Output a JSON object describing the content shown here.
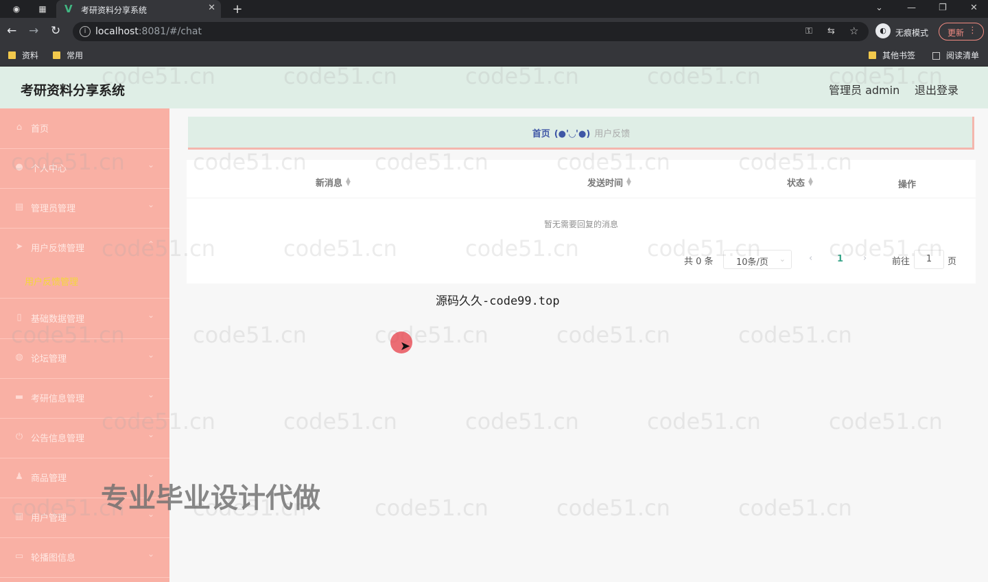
{
  "browser": {
    "tab_title": "考研资料分享系统",
    "tab_favicon": "V",
    "url_host": "localhost",
    "url_rest": ":8081/#/chat",
    "incognito_label": "无痕模式",
    "update_label": "更新",
    "bookmarks": [
      "资料",
      "常用"
    ],
    "bookmarks_right": [
      "其他书签",
      "阅读清单"
    ]
  },
  "app": {
    "brand": "考研资料分享系统",
    "user": "管理员 admin",
    "logout": "退出登录"
  },
  "sidebar": {
    "items": [
      {
        "label": "首页",
        "icon": "home-icon"
      },
      {
        "label": "个人中心",
        "icon": "user-icon"
      },
      {
        "label": "管理员管理",
        "icon": "clipboard-icon"
      },
      {
        "label": "用户反馈管理",
        "icon": "send-icon"
      },
      {
        "label": "基础数据管理",
        "icon": "phone-icon"
      },
      {
        "label": "论坛管理",
        "icon": "globe-icon"
      },
      {
        "label": "考研信息管理",
        "icon": "message-icon"
      },
      {
        "label": "公告信息管理",
        "icon": "power-icon"
      },
      {
        "label": "商品管理",
        "icon": "person-icon"
      },
      {
        "label": "用户管理",
        "icon": "chart-icon"
      },
      {
        "label": "轮播图信息",
        "icon": "chat-icon"
      }
    ],
    "active_sub": "用户反馈管理"
  },
  "breadcrumb": {
    "home": "首页",
    "face": "(●'◡'●)",
    "current": "用户反馈"
  },
  "table": {
    "columns": [
      "新消息",
      "发送时间",
      "状态",
      "操作"
    ],
    "empty_text": "暂无需要回复的消息"
  },
  "pagination": {
    "total": "共 0 条",
    "page_size": "10条/页",
    "current_page": "1",
    "goto_label": "前往",
    "goto_value": "1",
    "page_unit": "页"
  },
  "overlays": {
    "watermark": "code51.cn",
    "source_text": "源码久久-code99.top",
    "ad_text": "专业毕业设计代做"
  },
  "colors": {
    "sidebar_bg": "#f9b0a4",
    "topnav_bg": "#dfeee6",
    "submenu_active": "#f4d73a",
    "accent_blue": "#3f57a6"
  }
}
